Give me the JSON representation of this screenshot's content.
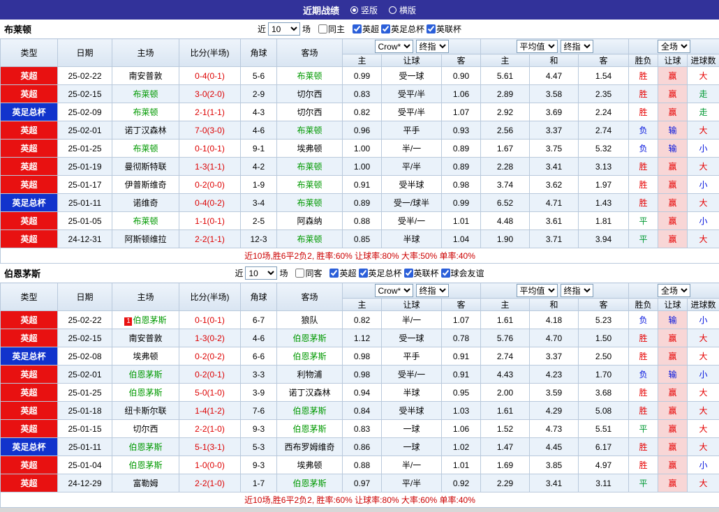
{
  "title_bar": {
    "title": "近期战绩",
    "layout_options": [
      {
        "label": "竖版",
        "selected": true
      },
      {
        "label": "横版",
        "selected": false
      }
    ]
  },
  "filter_labels": {
    "near": "近",
    "count": "10",
    "matches": "场"
  },
  "table_header": {
    "type": "类型",
    "date": "日期",
    "home": "主场",
    "score_half": "比分(半场)",
    "corners": "角球",
    "away": "客场",
    "bookmaker_select": "Crow*",
    "final_index_select": "终指",
    "average_select": "平均值",
    "full_match_select": "全场",
    "asia_home": "主",
    "asia_line": "让球",
    "asia_away": "客",
    "euro_home": "主",
    "euro_draw": "和",
    "euro_away": "客",
    "result_wl": "胜负",
    "result_handicap": "让球",
    "result_goals": "进球数"
  },
  "sections": [
    {
      "team": "布莱顿",
      "same_venue": {
        "label": "同主",
        "checked": false
      },
      "competitions": [
        {
          "label": "英超",
          "checked": true
        },
        {
          "label": "英足总杯",
          "checked": true
        },
        {
          "label": "英联杯",
          "checked": true
        }
      ],
      "rows": [
        {
          "type": "英超",
          "date": "25-02-22",
          "home": "南安普敦",
          "score": "0-4(0-1)",
          "corner": "5-6",
          "away": "布莱顿",
          "aHome": "0.99",
          "line": "受一球",
          "aAway": "0.90",
          "eHome": "5.61",
          "eDraw": "4.47",
          "eAway": "1.54",
          "wl": "胜",
          "hc": "赢",
          "goals": "大"
        },
        {
          "type": "英超",
          "date": "25-02-15",
          "home": "布莱顿",
          "score": "3-0(2-0)",
          "corner": "2-9",
          "away": "切尔西",
          "aHome": "0.83",
          "line": "受平/半",
          "aAway": "1.06",
          "eHome": "2.89",
          "eDraw": "3.58",
          "eAway": "2.35",
          "wl": "胜",
          "hc": "赢",
          "goals": "走"
        },
        {
          "type": "英足总杯",
          "date": "25-02-09",
          "home": "布莱顿",
          "score": "2-1(1-1)",
          "corner": "4-3",
          "away": "切尔西",
          "aHome": "0.82",
          "line": "受平/半",
          "aAway": "1.07",
          "eHome": "2.92",
          "eDraw": "3.69",
          "eAway": "2.24",
          "wl": "胜",
          "hc": "赢",
          "goals": "走"
        },
        {
          "type": "英超",
          "date": "25-02-01",
          "home": "诺丁汉森林",
          "score": "7-0(3-0)",
          "corner": "4-6",
          "away": "布莱顿",
          "aHome": "0.96",
          "line": "平手",
          "aAway": "0.93",
          "eHome": "2.56",
          "eDraw": "3.37",
          "eAway": "2.74",
          "wl": "负",
          "hc": "输",
          "goals": "大"
        },
        {
          "type": "英超",
          "date": "25-01-25",
          "home": "布莱顿",
          "score": "0-1(0-1)",
          "corner": "9-1",
          "away": "埃弗顿",
          "aHome": "1.00",
          "line": "半/一",
          "aAway": "0.89",
          "eHome": "1.67",
          "eDraw": "3.75",
          "eAway": "5.32",
          "wl": "负",
          "hc": "输",
          "goals": "小"
        },
        {
          "type": "英超",
          "date": "25-01-19",
          "home": "曼彻斯特联",
          "score": "1-3(1-1)",
          "corner": "4-2",
          "away": "布莱顿",
          "aHome": "1.00",
          "line": "平/半",
          "aAway": "0.89",
          "eHome": "2.28",
          "eDraw": "3.41",
          "eAway": "3.13",
          "wl": "胜",
          "hc": "赢",
          "goals": "大"
        },
        {
          "type": "英超",
          "date": "25-01-17",
          "home": "伊普斯维奇",
          "score": "0-2(0-0)",
          "corner": "1-9",
          "away": "布莱顿",
          "aHome": "0.91",
          "line": "受半球",
          "aAway": "0.98",
          "eHome": "3.74",
          "eDraw": "3.62",
          "eAway": "1.97",
          "wl": "胜",
          "hc": "赢",
          "goals": "小"
        },
        {
          "type": "英足总杯",
          "date": "25-01-11",
          "home": "诺维奇",
          "score": "0-4(0-2)",
          "corner": "3-4",
          "away": "布莱顿",
          "aHome": "0.89",
          "line": "受一/球半",
          "aAway": "0.99",
          "eHome": "6.52",
          "eDraw": "4.71",
          "eAway": "1.43",
          "wl": "胜",
          "hc": "赢",
          "goals": "大"
        },
        {
          "type": "英超",
          "date": "25-01-05",
          "home": "布莱顿",
          "score": "1-1(0-1)",
          "corner": "2-5",
          "away": "阿森纳",
          "aHome": "0.88",
          "line": "受半/一",
          "aAway": "1.01",
          "eHome": "4.48",
          "eDraw": "3.61",
          "eAway": "1.81",
          "wl": "平",
          "hc": "赢",
          "goals": "小"
        },
        {
          "type": "英超",
          "date": "24-12-31",
          "home": "阿斯顿维拉",
          "score": "2-2(1-1)",
          "corner": "12-3",
          "away": "布莱顿",
          "aHome": "0.85",
          "line": "半球",
          "aAway": "1.04",
          "eHome": "1.90",
          "eDraw": "3.71",
          "eAway": "3.94",
          "wl": "平",
          "hc": "赢",
          "goals": "大"
        }
      ],
      "summary": "近10场,胜6平2负2, 胜率:60% 让球率:80% 大率:50% 单率:40%"
    },
    {
      "team": "伯恩茅斯",
      "same_venue": {
        "label": "同客",
        "checked": false
      },
      "competitions": [
        {
          "label": "英超",
          "checked": true
        },
        {
          "label": "英足总杯",
          "checked": true
        },
        {
          "label": "英联杯",
          "checked": true
        },
        {
          "label": "球会友谊",
          "checked": true
        }
      ],
      "rows": [
        {
          "type": "英超",
          "date": "25-02-22",
          "homeBadge": "1",
          "home": "伯恩茅斯",
          "score": "0-1(0-1)",
          "corner": "6-7",
          "away": "狼队",
          "aHome": "0.82",
          "line": "半/一",
          "aAway": "1.07",
          "eHome": "1.61",
          "eDraw": "4.18",
          "eAway": "5.23",
          "wl": "负",
          "hc": "输",
          "goals": "小"
        },
        {
          "type": "英超",
          "date": "25-02-15",
          "home": "南安普敦",
          "score": "1-3(0-2)",
          "corner": "4-6",
          "away": "伯恩茅斯",
          "aHome": "1.12",
          "line": "受一球",
          "aAway": "0.78",
          "eHome": "5.76",
          "eDraw": "4.70",
          "eAway": "1.50",
          "wl": "胜",
          "hc": "赢",
          "goals": "大"
        },
        {
          "type": "英足总杯",
          "date": "25-02-08",
          "home": "埃弗顿",
          "score": "0-2(0-2)",
          "corner": "6-6",
          "away": "伯恩茅斯",
          "aHome": "0.98",
          "line": "平手",
          "aAway": "0.91",
          "eHome": "2.74",
          "eDraw": "3.37",
          "eAway": "2.50",
          "wl": "胜",
          "hc": "赢",
          "goals": "大"
        },
        {
          "type": "英超",
          "date": "25-02-01",
          "home": "伯恩茅斯",
          "score": "0-2(0-1)",
          "corner": "3-3",
          "away": "利物浦",
          "aHome": "0.98",
          "line": "受半/一",
          "aAway": "0.91",
          "eHome": "4.43",
          "eDraw": "4.23",
          "eAway": "1.70",
          "wl": "负",
          "hc": "输",
          "goals": "小"
        },
        {
          "type": "英超",
          "date": "25-01-25",
          "home": "伯恩茅斯",
          "score": "5-0(1-0)",
          "corner": "3-9",
          "away": "诺丁汉森林",
          "aHome": "0.94",
          "line": "半球",
          "aAway": "0.95",
          "eHome": "2.00",
          "eDraw": "3.59",
          "eAway": "3.68",
          "wl": "胜",
          "hc": "赢",
          "goals": "大"
        },
        {
          "type": "英超",
          "date": "25-01-18",
          "home": "纽卡斯尔联",
          "score": "1-4(1-2)",
          "corner": "7-6",
          "away": "伯恩茅斯",
          "aHome": "0.84",
          "line": "受半球",
          "aAway": "1.03",
          "eHome": "1.61",
          "eDraw": "4.29",
          "eAway": "5.08",
          "wl": "胜",
          "hc": "赢",
          "goals": "大"
        },
        {
          "type": "英超",
          "date": "25-01-15",
          "home": "切尔西",
          "score": "2-2(1-0)",
          "corner": "9-3",
          "away": "伯恩茅斯",
          "aHome": "0.83",
          "line": "一球",
          "aAway": "1.06",
          "eHome": "1.52",
          "eDraw": "4.73",
          "eAway": "5.51",
          "wl": "平",
          "hc": "赢",
          "goals": "大"
        },
        {
          "type": "英足总杯",
          "date": "25-01-11",
          "home": "伯恩茅斯",
          "score": "5-1(3-1)",
          "corner": "5-3",
          "away": "西布罗姆维奇",
          "aHome": "0.86",
          "line": "一球",
          "aAway": "1.02",
          "eHome": "1.47",
          "eDraw": "4.45",
          "eAway": "6.17",
          "wl": "胜",
          "hc": "赢",
          "goals": "大"
        },
        {
          "type": "英超",
          "date": "25-01-04",
          "home": "伯恩茅斯",
          "score": "1-0(0-0)",
          "corner": "9-3",
          "away": "埃弗顿",
          "aHome": "0.88",
          "line": "半/一",
          "aAway": "1.01",
          "eHome": "1.69",
          "eDraw": "3.85",
          "eAway": "4.97",
          "wl": "胜",
          "hc": "赢",
          "goals": "小"
        },
        {
          "type": "英超",
          "date": "24-12-29",
          "home": "富勒姆",
          "score": "2-2(1-0)",
          "corner": "1-7",
          "away": "伯恩茅斯",
          "aHome": "0.97",
          "line": "平/半",
          "aAway": "0.92",
          "eHome": "2.29",
          "eDraw": "3.41",
          "eAway": "3.11",
          "wl": "平",
          "hc": "赢",
          "goals": "大"
        }
      ],
      "summary": "近10场,胜6平2负2, 胜率:60% 让球率:80% 大率:60% 单率:40%"
    }
  ],
  "colors": {
    "title_bar_bg": "#32329a",
    "league_badge_red": "#e81111",
    "cup_badge_blue": "#1133cc",
    "win_red": "#e60000",
    "loss_blue": "#0011dd",
    "draw_green": "#009933",
    "focus_team_green": "#009900",
    "handicap_column_pink": "#f8d6d6",
    "alt_row_blue": "#eaf2fa"
  }
}
